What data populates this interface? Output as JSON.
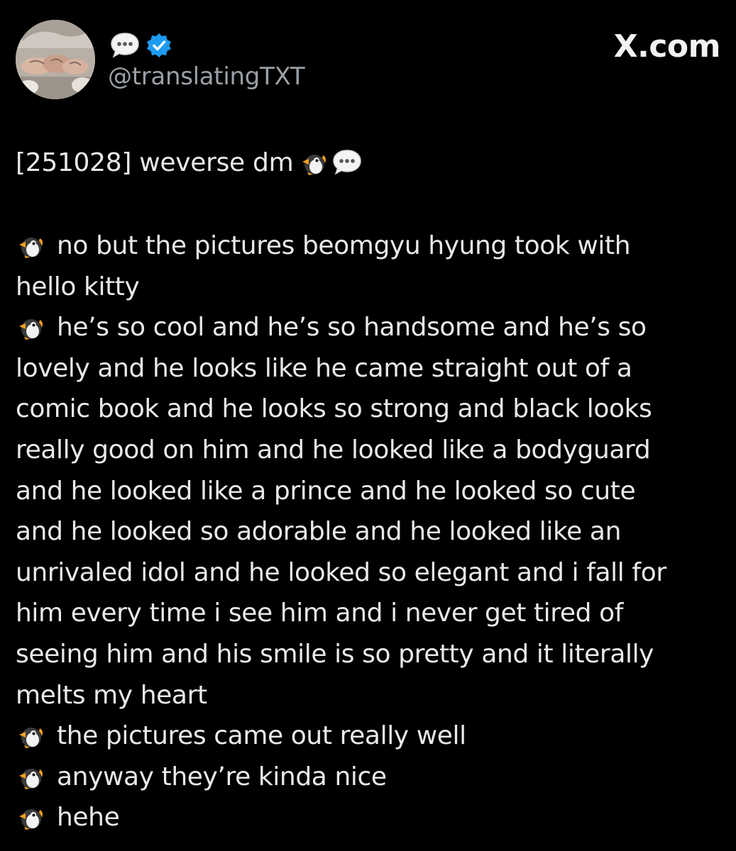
{
  "header": {
    "handle": "@translatingTXT",
    "site_logo": "X.com",
    "icons": {
      "name_emoji": "speech-bubble-icon",
      "badge": "verified-badge-icon",
      "avatar": "profile-avatar"
    },
    "colors": {
      "verified": "#1d9bf0",
      "background": "#000000",
      "text": "#e7e9ea",
      "handle": "#9aa0a6"
    }
  },
  "tweet": {
    "title": "[251028] weverse dm",
    "title_icons": [
      "penguin-icon",
      "speech-bubble-icon"
    ],
    "lines": [
      {
        "penguin": true,
        "text": "no but the pictures beomgyu hyung took with"
      },
      {
        "penguin": false,
        "text": "hello kitty"
      },
      {
        "penguin": true,
        "text": "he’s so cool and he’s so handsome and he’s so"
      },
      {
        "penguin": false,
        "text": "lovely and he looks like he came straight out of a"
      },
      {
        "penguin": false,
        "text": "comic book and he looks so strong and black looks"
      },
      {
        "penguin": false,
        "text": "really good on him and he looked like a bodyguard"
      },
      {
        "penguin": false,
        "text": "and he looked like a prince and he looked so cute"
      },
      {
        "penguin": false,
        "text": "and he looked so adorable and he looked like an"
      },
      {
        "penguin": false,
        "text": "unrivaled idol and he looked so elegant and i fall for"
      },
      {
        "penguin": false,
        "text": "him every time i see him and i never get tired of"
      },
      {
        "penguin": false,
        "text": "seeing him and his smile is so pretty and it literally"
      },
      {
        "penguin": false,
        "text": "melts my heart"
      },
      {
        "penguin": true,
        "text": "the pictures came out really well"
      },
      {
        "penguin": true,
        "text": "anyway they’re kinda nice"
      },
      {
        "penguin": true,
        "text": "hehe"
      }
    ]
  }
}
